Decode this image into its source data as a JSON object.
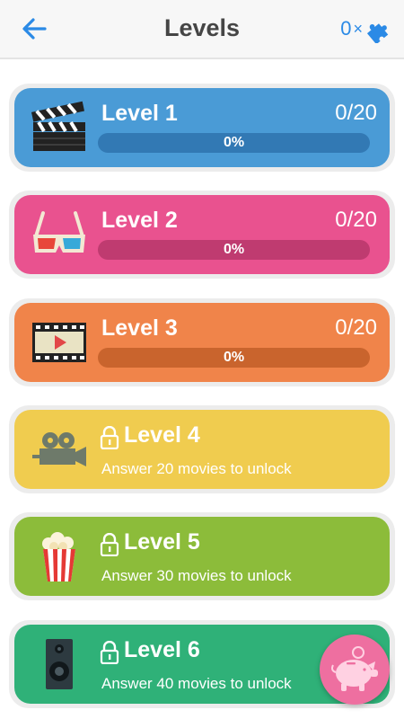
{
  "header": {
    "title": "Levels",
    "hint_count": "0",
    "hint_multiplier": "×"
  },
  "levels": [
    {
      "name": "Level 1",
      "count": "0/20",
      "percent_label": "0%",
      "progress": 0,
      "icon": "clapperboard-icon",
      "color": "#4a9bd6",
      "bar_color": "#3279b4"
    },
    {
      "name": "Level 2",
      "count": "0/20",
      "percent_label": "0%",
      "progress": 0,
      "icon": "3d-glasses-icon",
      "color": "#e9528f",
      "bar_color": "#bf3b70"
    },
    {
      "name": "Level 3",
      "count": "0/20",
      "percent_label": "0%",
      "progress": 0,
      "icon": "film-play-icon",
      "color": "#f0844a",
      "bar_color": "#c9642d"
    },
    {
      "name": "Level 4",
      "unlock_text": "Answer 20 movies to unlock",
      "icon": "movie-camera-icon",
      "color": "#f0cc4f"
    },
    {
      "name": "Level 5",
      "unlock_text": "Answer 30 movies to unlock",
      "icon": "popcorn-icon",
      "color": "#8cbc3a"
    },
    {
      "name": "Level 6",
      "unlock_text": "Answer 40 movies to unlock",
      "icon": "speaker-icon",
      "color": "#2fb178"
    }
  ],
  "fab": {
    "icon": "piggy-bank-icon",
    "color": "#ee6fa0"
  }
}
